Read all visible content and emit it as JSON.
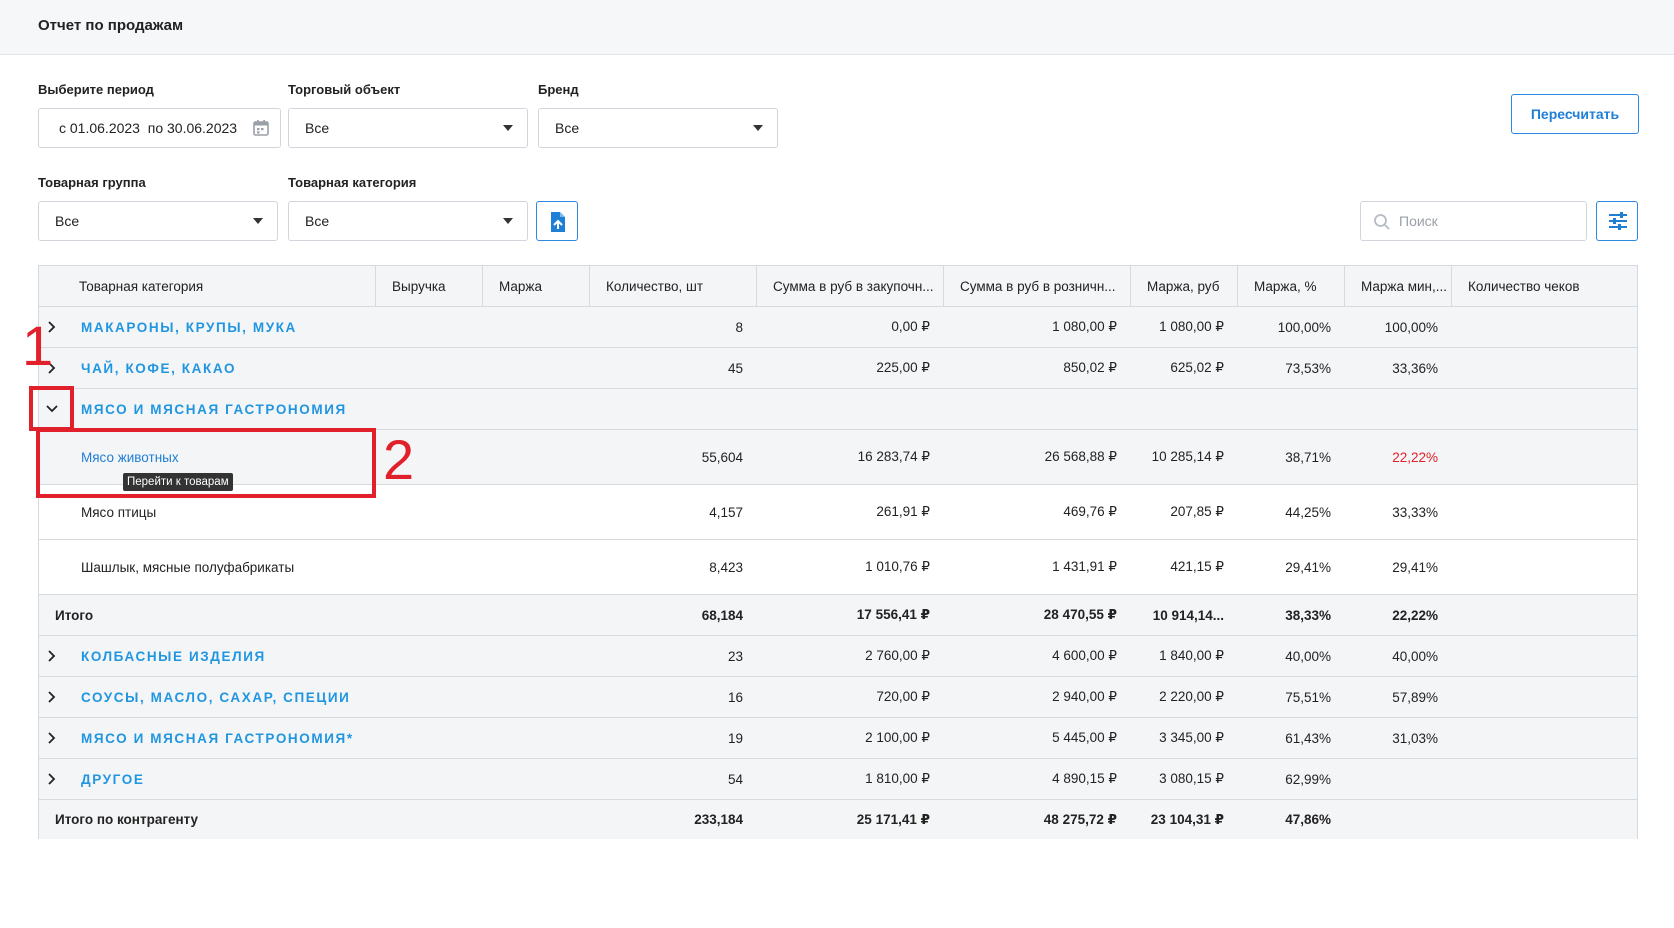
{
  "page": {
    "title": "Отчет по продажам"
  },
  "filters": {
    "period_label": "Выберите период",
    "period_value": "с 01.06.2023  по 30.06.2023",
    "store_label": "Торговый объект",
    "store_value": "Все",
    "brand_label": "Бренд",
    "brand_value": "Все",
    "group_label": "Товарная группа",
    "group_value": "Все",
    "category_label": "Товарная категория",
    "category_value": "Все"
  },
  "actions": {
    "recalc_label": "Пересчитать"
  },
  "search": {
    "placeholder": "Поиск"
  },
  "table": {
    "headers": [
      "Товарная категория",
      "Выручка",
      "Маржа",
      "Количество, шт",
      "Сумма в руб в закупочн...",
      "Сумма в руб в розничн...",
      "Маржа, руб",
      "Маржа, %",
      "Маржа мин,...",
      "Количество чеков"
    ],
    "rows": [
      {
        "name": "МАКАРОНЫ, КРУПЫ, МУКА",
        "qty": "8",
        "purchase": "0,00 ₽",
        "retail": "1 080,00 ₽",
        "margin_rub": "1 080,00 ₽",
        "margin_pct": "100,00%",
        "margin_min": "100,00%"
      },
      {
        "name": "ЧАЙ, КОФЕ, КАКАО",
        "qty": "45",
        "purchase": "225,00 ₽",
        "retail": "850,02 ₽",
        "margin_rub": "625,02 ₽",
        "margin_pct": "73,53%",
        "margin_min": "33,36%"
      },
      {
        "name": "МЯСО И МЯСНАЯ ГАСТРОНОМИЯ"
      },
      {
        "name": "Мясо животных",
        "qty": "55,604",
        "purchase": "16 283,74 ₽",
        "retail": "26 568,88 ₽",
        "margin_rub": "10 285,14 ₽",
        "margin_pct": "38,71%",
        "margin_min": "22,22%"
      },
      {
        "name": "Мясо птицы",
        "qty": "4,157",
        "purchase": "261,91 ₽",
        "retail": "469,76 ₽",
        "margin_rub": "207,85 ₽",
        "margin_pct": "44,25%",
        "margin_min": "33,33%"
      },
      {
        "name": "Шашлык, мясные полуфабрикаты",
        "qty": "8,423",
        "purchase": "1 010,76 ₽",
        "retail": "1 431,91 ₽",
        "margin_rub": "421,15 ₽",
        "margin_pct": "29,41%",
        "margin_min": "29,41%"
      },
      {
        "name": "Итого",
        "qty": "68,184",
        "purchase": "17 556,41 ₽",
        "retail": "28 470,55 ₽",
        "margin_rub": "10 914,14...",
        "margin_pct": "38,33%",
        "margin_min": "22,22%"
      },
      {
        "name": "КОЛБАСНЫЕ ИЗДЕЛИЯ",
        "qty": "23",
        "purchase": "2 760,00 ₽",
        "retail": "4 600,00 ₽",
        "margin_rub": "1 840,00 ₽",
        "margin_pct": "40,00%",
        "margin_min": "40,00%"
      },
      {
        "name": "СОУСЫ, МАСЛО, САХАР, СПЕЦИИ",
        "qty": "16",
        "purchase": "720,00 ₽",
        "retail": "2 940,00 ₽",
        "margin_rub": "2 220,00 ₽",
        "margin_pct": "75,51%",
        "margin_min": "57,89%"
      },
      {
        "name": "МЯСО И МЯСНАЯ ГАСТРОНОМИЯ*",
        "qty": "19",
        "purchase": "2 100,00 ₽",
        "retail": "5 445,00 ₽",
        "margin_rub": "3 345,00 ₽",
        "margin_pct": "61,43%",
        "margin_min": "31,03%"
      },
      {
        "name": "ДРУГОЕ",
        "qty": "54",
        "purchase": "1 810,00 ₽",
        "retail": "4 890,15 ₽",
        "margin_rub": "3 080,15 ₽",
        "margin_pct": "62,99%",
        "margin_min": ""
      },
      {
        "name": "Итого по контрагенту",
        "qty": "233,184",
        "purchase": "25 171,41 ₽",
        "retail": "48 275,72 ₽",
        "margin_rub": "23 104,31 ₽",
        "margin_pct": "47,86%",
        "margin_min": ""
      }
    ]
  },
  "tooltip": {
    "text": "Перейти к товарам"
  },
  "annotations": {
    "marker_1": "1",
    "marker_2": "2"
  },
  "colors": {
    "accent": "#2196e0",
    "link": "#1f7fd6",
    "annotation": "#e0202a",
    "negative": "#e2202a"
  },
  "icons": [
    "calendar-icon",
    "caret-down-icon",
    "export-file-icon",
    "search-icon",
    "settings-sliders-icon",
    "chevron-right-icon",
    "chevron-down-icon"
  ]
}
